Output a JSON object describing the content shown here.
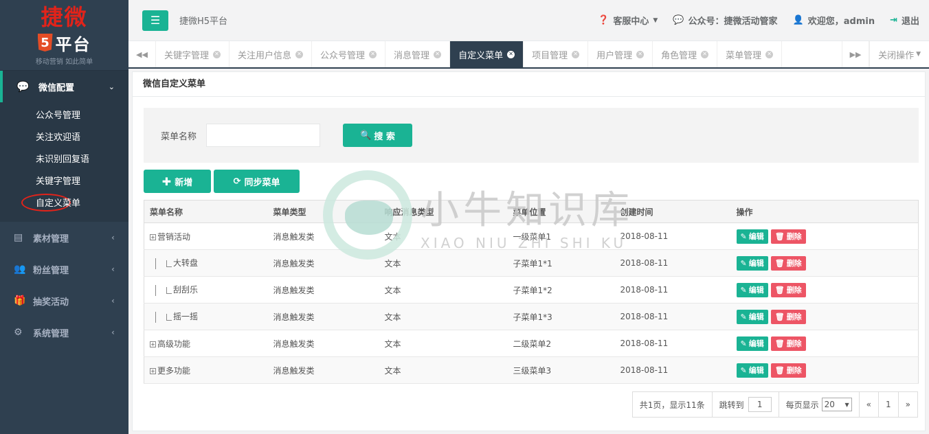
{
  "brand": {
    "top": "捷微",
    "h5": "5",
    "platform": "平台",
    "slogan": "移动营销 如此简单"
  },
  "sidebar": {
    "active_group": {
      "label": "微信配置",
      "icon": "wechat-icon"
    },
    "sub_items": [
      {
        "label": "公众号管理"
      },
      {
        "label": "关注欢迎语"
      },
      {
        "label": "未识别回复语"
      },
      {
        "label": "关键字管理"
      },
      {
        "label": "自定义菜单"
      }
    ],
    "groups": [
      {
        "label": "素材管理",
        "icon": "newspaper-icon"
      },
      {
        "label": "粉丝管理",
        "icon": "users-icon"
      },
      {
        "label": "抽奖活动",
        "icon": "gift-icon"
      },
      {
        "label": "系统管理",
        "icon": "gear-icon"
      }
    ]
  },
  "topbar": {
    "site_name": "捷微H5平台",
    "help": "客服中心",
    "account": "公众号：捷微活动管家",
    "welcome": "欢迎您，admin",
    "logout": "退出"
  },
  "tabs": [
    {
      "label": "关键字管理"
    },
    {
      "label": "关注用户信息"
    },
    {
      "label": "公众号管理"
    },
    {
      "label": "消息管理"
    },
    {
      "label": "自定义菜单"
    },
    {
      "label": "项目管理"
    },
    {
      "label": "用户管理"
    },
    {
      "label": "角色管理"
    },
    {
      "label": "菜单管理"
    }
  ],
  "tab_close_ops": "关闭操作",
  "panel": {
    "title": "微信自定义菜单"
  },
  "search": {
    "label": "菜单名称",
    "value": "",
    "button": "搜 索"
  },
  "actions": {
    "add": "新增",
    "sync": "同步菜单"
  },
  "table": {
    "headers": [
      "菜单名称",
      "菜单类型",
      "响应消息类型",
      "菜单位置",
      "创建时间",
      "操作"
    ],
    "rows": [
      {
        "name": "营销活动",
        "type": "消息触发类",
        "msg": "文本",
        "pos": "一级菜单1",
        "date": "2018-08-11"
      },
      {
        "name": "大转盘",
        "type": "消息触发类",
        "msg": "文本",
        "pos": "子菜单1*1",
        "date": "2018-08-11"
      },
      {
        "name": "刮刮乐",
        "type": "消息触发类",
        "msg": "文本",
        "pos": "子菜单1*2",
        "date": "2018-08-11"
      },
      {
        "name": "摇一摇",
        "type": "消息触发类",
        "msg": "文本",
        "pos": "子菜单1*3",
        "date": "2018-08-11"
      },
      {
        "name": "高级功能",
        "type": "消息触发类",
        "msg": "文本",
        "pos": "二级菜单2",
        "date": "2018-08-11"
      },
      {
        "name": "更多功能",
        "type": "消息触发类",
        "msg": "文本",
        "pos": "三级菜单3",
        "date": "2018-08-11"
      }
    ],
    "edit": "编辑",
    "delete": "删除"
  },
  "pager": {
    "summary": "共1页，显示11条",
    "jump_label": "跳转到",
    "jump_value": "1",
    "size_label": "每页显示",
    "size_value": "20",
    "prev": "«",
    "page": "1",
    "next": "»"
  },
  "watermark": {
    "cn": "小牛知识库",
    "en": "XIAO NIU ZHI SHI KU"
  },
  "colors": {
    "accent": "#1ab394",
    "sidebar": "#2f4050",
    "danger": "#ed5565"
  }
}
